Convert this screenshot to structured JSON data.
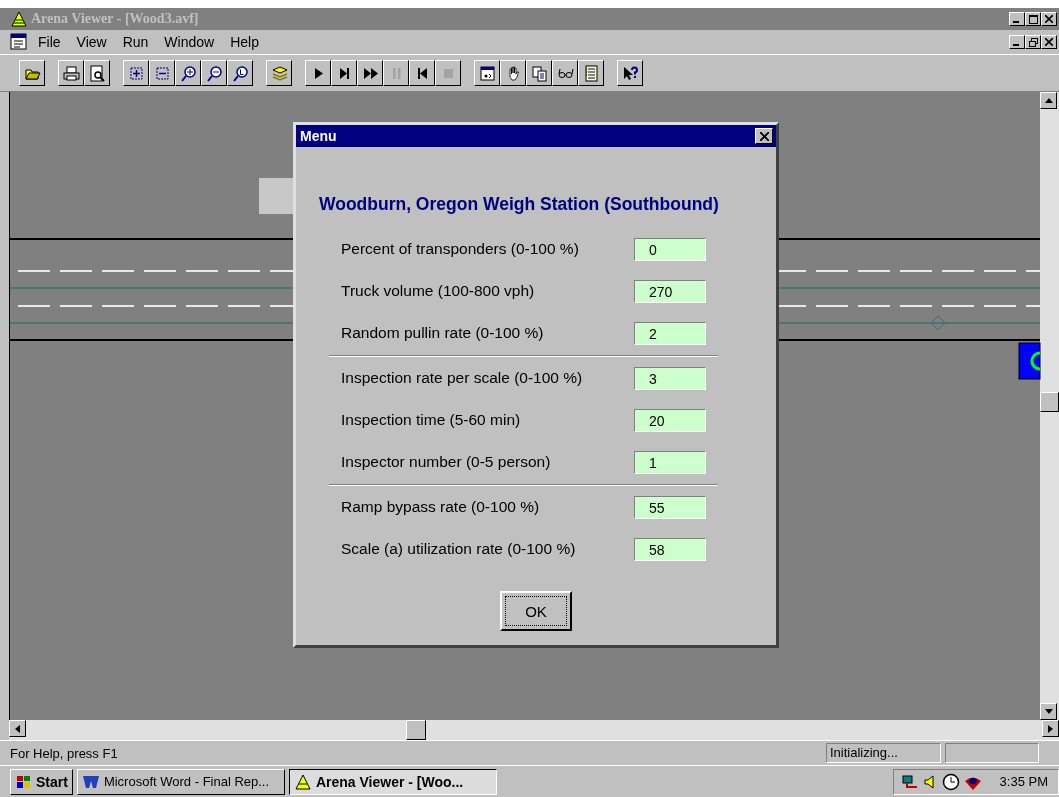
{
  "window": {
    "title": "Arena Viewer - [Wood3.avf]"
  },
  "menu": [
    "File",
    "View",
    "Run",
    "Window",
    "Help"
  ],
  "toolbar": [
    [
      {
        "kind": "open",
        "disabled": false
      }
    ],
    [
      {
        "kind": "print",
        "disabled": false
      },
      {
        "kind": "preview",
        "disabled": false
      }
    ],
    [
      {
        "kind": "fit-in",
        "disabled": false
      },
      {
        "kind": "fit-out",
        "disabled": false
      },
      {
        "kind": "zoom-in",
        "disabled": false
      },
      {
        "kind": "zoom-out",
        "disabled": false
      },
      {
        "kind": "zoom-reset",
        "disabled": false
      }
    ],
    [
      {
        "kind": "layers",
        "disabled": false
      }
    ],
    [
      {
        "kind": "play",
        "disabled": false
      },
      {
        "kind": "step",
        "disabled": false
      },
      {
        "kind": "fast",
        "disabled": false
      },
      {
        "kind": "pause",
        "disabled": true
      },
      {
        "kind": "rewind",
        "disabled": false
      },
      {
        "kind": "stop",
        "disabled": true
      }
    ],
    [
      {
        "kind": "view",
        "disabled": false
      },
      {
        "kind": "hand",
        "disabled": false
      },
      {
        "kind": "copy",
        "disabled": false
      },
      {
        "kind": "glasses",
        "disabled": false
      },
      {
        "kind": "list",
        "disabled": false
      }
    ],
    [
      {
        "kind": "help",
        "disabled": false
      }
    ]
  ],
  "dialog": {
    "title": "Menu",
    "heading": "Woodburn, Oregon Weigh Station (Southbound)",
    "groups": [
      [
        {
          "label": "Percent of transponders (0-100 %)",
          "value": "0"
        },
        {
          "label": "Truck volume (100-800 vph)",
          "value": "270"
        },
        {
          "label": "Random pullin rate (0-100 %)",
          "value": "2"
        }
      ],
      [
        {
          "label": "Inspection rate per scale (0-100 %)",
          "value": "3"
        },
        {
          "label": "Inspection time (5-60 min)",
          "value": "20"
        },
        {
          "label": "Inspector number (0-5 person)",
          "value": "1"
        }
      ],
      [
        {
          "label": "Ramp bypass rate (0-100 %)",
          "value": "55"
        },
        {
          "label": "Scale (a) utilization rate (0-100 %)",
          "value": "58"
        }
      ]
    ],
    "button": "OK"
  },
  "status_bar": {
    "message": "For Help, press F1",
    "state": "Initializing..."
  },
  "taskbar": {
    "start": "Start",
    "tasks": [
      {
        "label": "Microsoft Word - Final Rep...",
        "kind": "word",
        "selected": false
      },
      {
        "label": "Arena Viewer - [Woo...",
        "kind": "arena",
        "selected": true
      }
    ],
    "clock": "3:35 PM"
  }
}
